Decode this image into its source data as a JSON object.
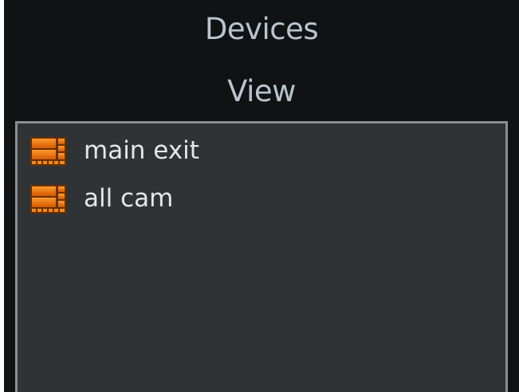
{
  "tabs": {
    "devices_label": "Devices",
    "view_label": "View"
  },
  "views_list": {
    "items": [
      {
        "label": "main exit",
        "icon": "video-grid-icon"
      },
      {
        "label": "all cam",
        "icon": "video-grid-icon"
      }
    ]
  },
  "colors": {
    "panel_background": "#111213",
    "list_background": "#2f3336",
    "tab_text": "#b9c4cf",
    "item_text": "#e3e6ea",
    "icon_orange": "#e8700a"
  }
}
